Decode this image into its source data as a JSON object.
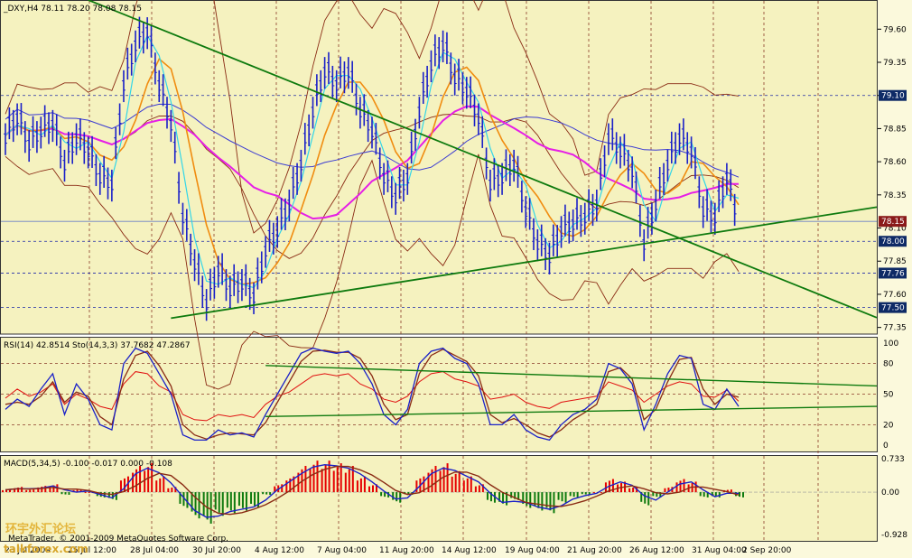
{
  "colors": {
    "background": "#f5f2bf",
    "grid": "#8a3a28",
    "price_bars": "#1a20c8",
    "ma_cyan": "#33d6e8",
    "ma_orange": "#f08c10",
    "ma_magenta": "#e61ee6",
    "ma_blue": "#3b3bd2",
    "bollinger": "#8a2b14",
    "trendline": "#0e7a0e",
    "rsi": "#e01010",
    "stoch_main": "#1a20c8",
    "stoch_signal": "#8a2b14",
    "macd_up": "#e60000",
    "macd_down": "#0e7a0e",
    "current_price_box": "#0e2a66"
  },
  "header": {
    "main": "_DXY,H4  78.11 78.20 78.08 78.15",
    "rsi": "RSI(14) 42.8514  Sto(14,3,3) 37.7682 47.2867",
    "macd": "MACD(5,34,5) -0.100 -0.017 0.000 -0.108"
  },
  "watermark": {
    "chinese": "环宇外汇论坛",
    "site": "talkforex.com",
    "copyright": "MetaTrader, © 2001-2009 MetaQuotes Software Corp."
  },
  "x_axis": {
    "labels": [
      "23 Jul 2009",
      "25 Jul 12:00",
      "28 Jul 04:00",
      "30 Jul 20:00",
      "4 Aug 12:00",
      "7 Aug 04:00",
      "11 Aug 20:00",
      "14 Aug 12:00",
      "19 Aug 04:00",
      "21 Aug 20:00",
      "26 Aug 12:00",
      "31 Aug 04:00",
      "2 Sep 20:00"
    ]
  },
  "main_axis": {
    "ticks": [
      "79.60",
      "79.35",
      "79.10",
      "78.85",
      "78.60",
      "78.35",
      "78.10",
      "77.85",
      "77.60",
      "77.35"
    ],
    "boxes": [
      "79.10",
      "78.15",
      "78.00",
      "77.76",
      "77.50"
    ],
    "current": "78.15",
    "ylim": [
      77.3,
      79.82
    ]
  },
  "rsi_axis": {
    "ticks": [
      "100",
      "80",
      "50",
      "20",
      "0"
    ]
  },
  "macd_axis": {
    "ticks": [
      "0.733",
      "0.00",
      "-0.928"
    ]
  },
  "chart_data": {
    "type": "line",
    "title": "_DXY,H4",
    "ohlc_last": {
      "open": 78.11,
      "high": 78.2,
      "low": 78.08,
      "close": 78.15
    },
    "close_series": [
      78.8,
      78.95,
      78.75,
      78.85,
      78.9,
      78.6,
      78.8,
      78.7,
      78.5,
      78.45,
      79.2,
      79.5,
      79.6,
      79.2,
      78.9,
      78.2,
      77.85,
      77.55,
      77.8,
      77.65,
      77.7,
      77.6,
      77.95,
      78.1,
      78.3,
      78.6,
      79.0,
      79.3,
      79.2,
      79.3,
      79.0,
      78.85,
      78.5,
      78.35,
      78.5,
      79.0,
      79.35,
      79.5,
      79.25,
      79.15,
      78.95,
      78.45,
      78.5,
      78.6,
      78.25,
      78.0,
      77.9,
      78.1,
      78.15,
      78.2,
      78.3,
      78.8,
      78.7,
      78.55,
      78.0,
      78.3,
      78.6,
      78.8,
      78.7,
      78.25,
      78.2,
      78.5,
      78.15
    ],
    "horizontal_levels": [
      79.1,
      78.0,
      77.76,
      77.5
    ],
    "trendlines": [
      {
        "from": [
          7,
          79.82
        ],
        "to": [
          66,
          77.7
        ]
      },
      {
        "from": [
          14,
          77.42
        ],
        "to": [
          66,
          78.15
        ]
      }
    ],
    "rsi_values": [
      46,
      55,
      48,
      52,
      60,
      40,
      50,
      45,
      38,
      35,
      60,
      72,
      70,
      58,
      52,
      30,
      25,
      24,
      30,
      28,
      30,
      27,
      40,
      48,
      52,
      60,
      68,
      70,
      68,
      70,
      60,
      55,
      45,
      42,
      48,
      62,
      70,
      72,
      65,
      62,
      58,
      45,
      47,
      50,
      42,
      38,
      36,
      42,
      44,
      46,
      48,
      62,
      58,
      54,
      42,
      50,
      58,
      62,
      60,
      48,
      47,
      54,
      43
    ],
    "stoch_main_values": [
      35,
      45,
      38,
      55,
      70,
      30,
      60,
      45,
      20,
      15,
      80,
      95,
      90,
      70,
      50,
      10,
      5,
      5,
      15,
      10,
      12,
      8,
      30,
      50,
      70,
      90,
      95,
      92,
      90,
      92,
      80,
      60,
      30,
      20,
      35,
      80,
      92,
      95,
      85,
      80,
      60,
      20,
      20,
      30,
      15,
      8,
      5,
      20,
      30,
      35,
      45,
      80,
      75,
      60,
      15,
      40,
      70,
      88,
      85,
      40,
      35,
      55,
      38
    ],
    "stoch_signal_values": [
      40,
      42,
      40,
      48,
      62,
      42,
      52,
      48,
      28,
      20,
      65,
      88,
      92,
      78,
      58,
      20,
      10,
      6,
      10,
      12,
      11,
      10,
      22,
      42,
      62,
      82,
      92,
      93,
      91,
      91,
      85,
      68,
      40,
      25,
      30,
      70,
      88,
      94,
      88,
      82,
      68,
      30,
      22,
      26,
      20,
      12,
      8,
      15,
      25,
      32,
      40,
      72,
      76,
      65,
      25,
      35,
      62,
      84,
      86,
      55,
      40,
      50,
      47
    ],
    "macd_hist": [
      0.05,
      0.1,
      0.05,
      0.12,
      0.15,
      -0.05,
      0.05,
      0.0,
      -0.1,
      -0.15,
      0.3,
      0.5,
      0.55,
      0.3,
      0.1,
      -0.3,
      -0.5,
      -0.6,
      -0.45,
      -0.4,
      -0.35,
      -0.3,
      -0.05,
      0.15,
      0.3,
      0.5,
      0.6,
      0.6,
      0.55,
      0.5,
      0.3,
      0.15,
      -0.1,
      -0.2,
      -0.05,
      0.3,
      0.5,
      0.55,
      0.4,
      0.3,
      0.15,
      -0.2,
      -0.25,
      -0.15,
      -0.3,
      -0.35,
      -0.4,
      -0.2,
      -0.1,
      -0.05,
      0.0,
      0.25,
      0.2,
      0.1,
      -0.25,
      -0.1,
      0.1,
      0.25,
      0.2,
      -0.1,
      -0.1,
      0.05,
      -0.1
    ]
  }
}
